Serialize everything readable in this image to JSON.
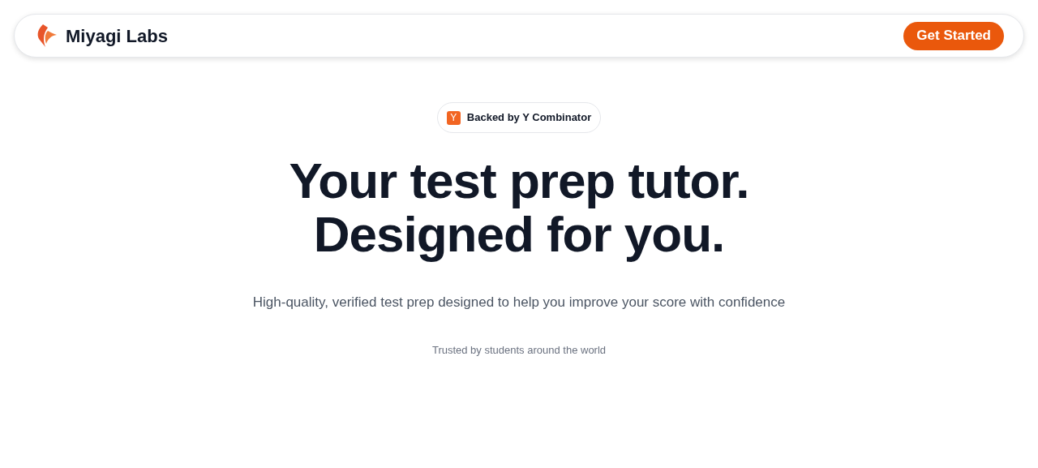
{
  "nav": {
    "brand": "Miyagi Labs",
    "cta": "Get Started"
  },
  "badge": {
    "mark": "Y",
    "label": "Backed by Y Combinator"
  },
  "hero": {
    "headline": [
      "Your test prep tutor.",
      "Designed for you."
    ],
    "subtitle": "High-quality, verified test prep designed to help you improve your score with confidence",
    "trust": "Trusted by students around the world"
  }
}
